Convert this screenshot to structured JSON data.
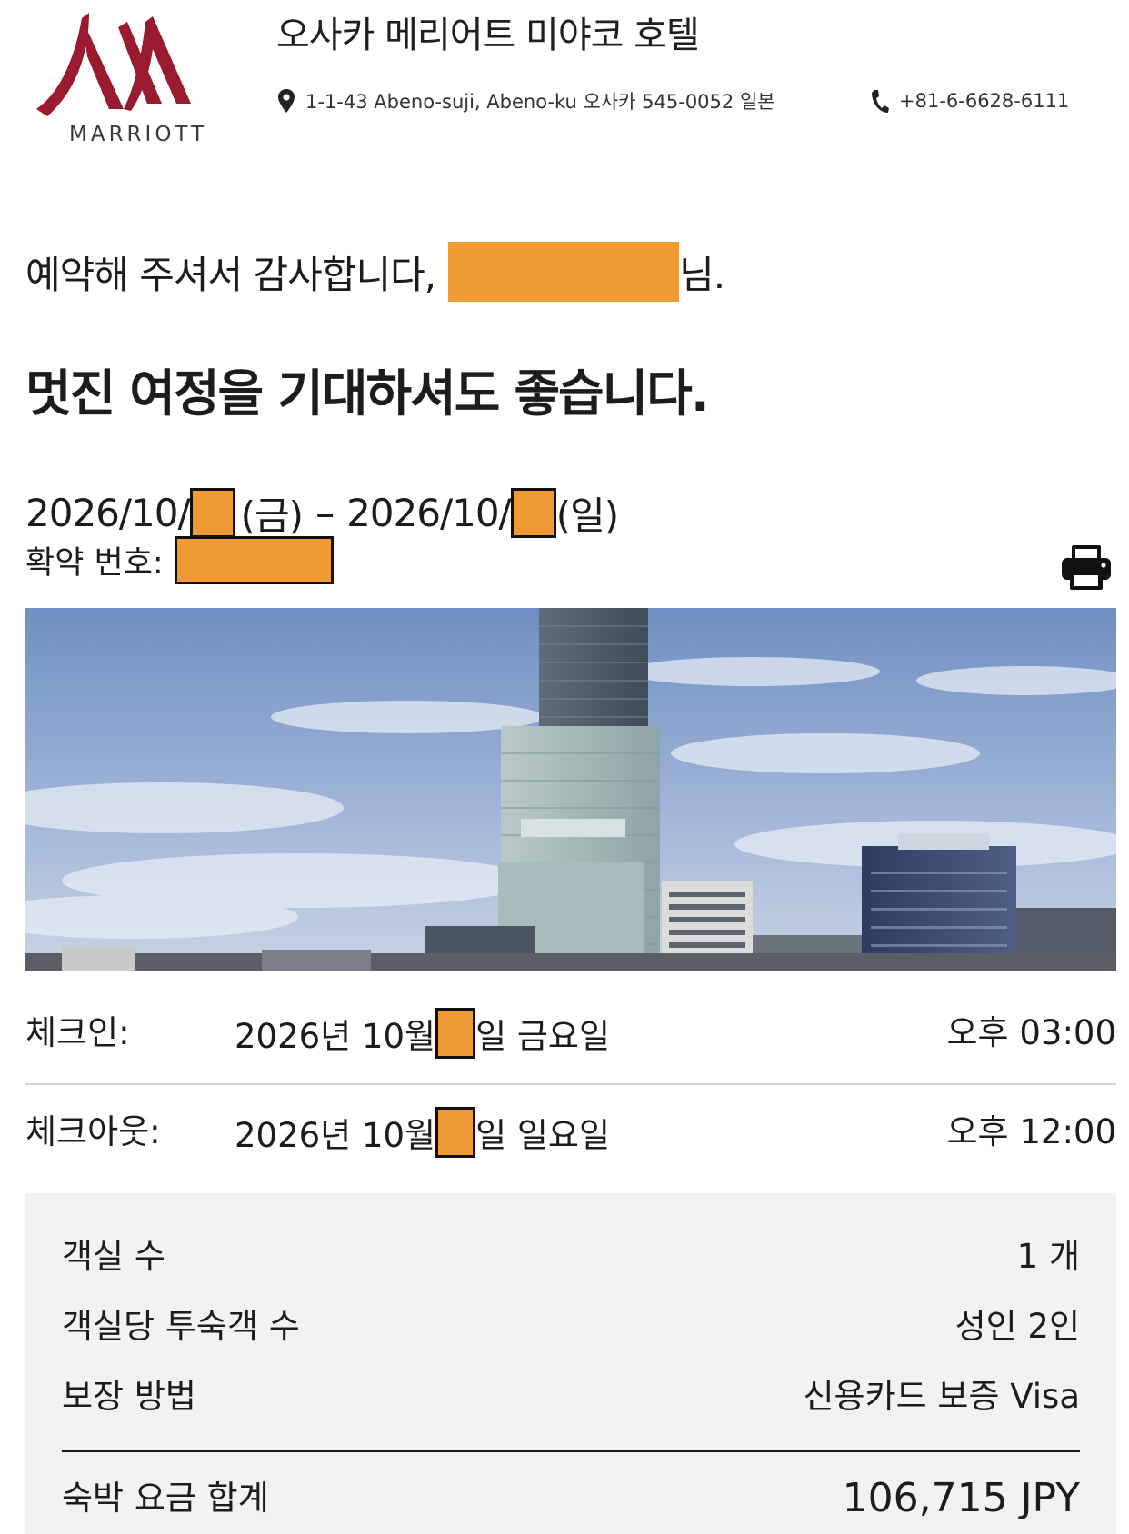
{
  "brand": {
    "wordmark": "MARRIOTT",
    "logo_color": "#9a1b2f"
  },
  "hotel": {
    "name": "오사카 메리어트 미야코 호텔",
    "address": "1-1-43 Abeno-suji, Abeno-ku 오사카 545-0052 일본",
    "phone": "+81-6-6628-6111"
  },
  "greeting": {
    "prefix": "예약해 주셔서 감사합니다,",
    "suffix": "님.",
    "headline": "멋진 여정을 기대하셔도 좋습니다."
  },
  "stay": {
    "start_prefix": "2026/10/",
    "start_day": "(금)",
    "separator": "–",
    "end_prefix": "2026/10/",
    "end_day": "(일)",
    "confirmation_label": "확약 번호:"
  },
  "checkin": {
    "label": "체크인:",
    "date_prefix": "2026년 10월",
    "date_suffix": "일 금요일",
    "time": "오후 03:00"
  },
  "checkout": {
    "label": "체크아웃:",
    "date_prefix": "2026년 10월",
    "date_suffix": "일 일요일",
    "time": "오후 12:00"
  },
  "summary": {
    "rooms_label": "객실 수",
    "rooms_value": "1 개",
    "guests_label": "객실당 투숙객 수",
    "guests_value": "성인 2인",
    "guarantee_label": "보장 방법",
    "guarantee_value": "신용카드 보증 Visa",
    "total_label": "숙박 요금 합계",
    "total_value": "106,715 JPY"
  },
  "colors": {
    "redaction": "#f09a36",
    "summary_bg": "#f2f2f2"
  },
  "icons": {
    "location": "location-pin-icon",
    "phone": "phone-icon",
    "print": "printer-icon"
  }
}
